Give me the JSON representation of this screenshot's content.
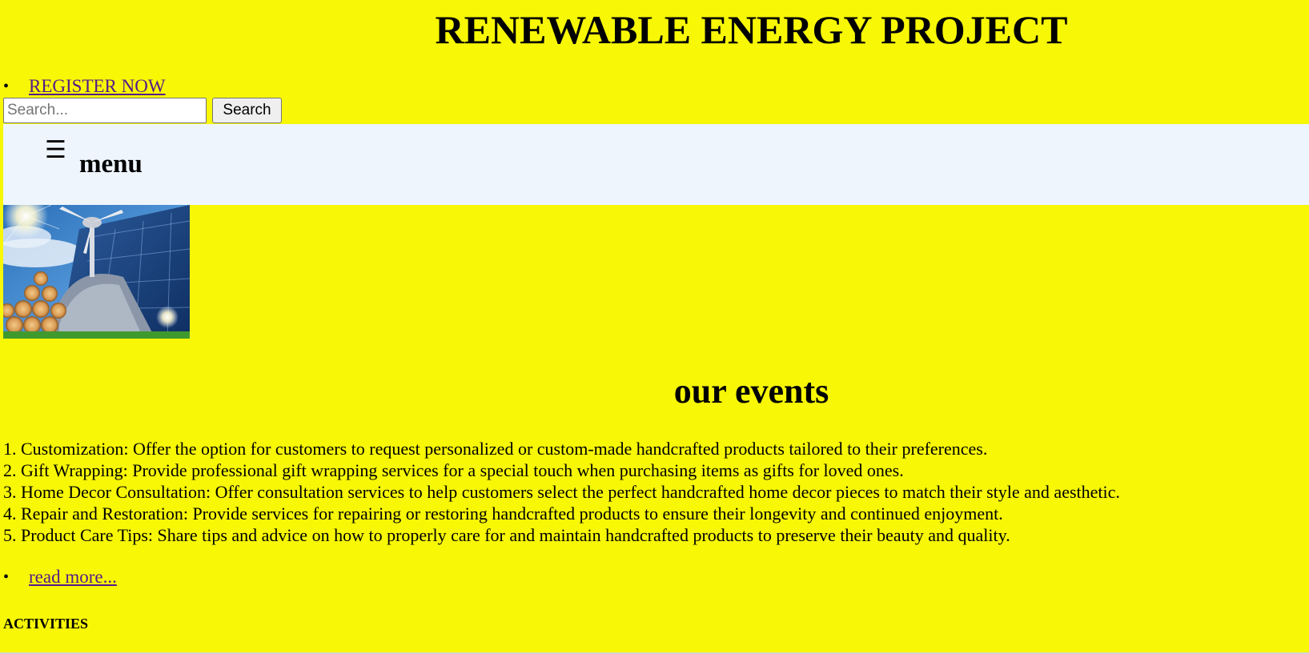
{
  "header": {
    "title": "RENEWABLE ENERGY PROJECT"
  },
  "nav": {
    "register_link": "REGISTER NOW"
  },
  "search": {
    "placeholder": "Search...",
    "value": "",
    "button_label": "Search"
  },
  "menu": {
    "icon": "☰",
    "icon_name": "hamburger-icon",
    "label": "menu"
  },
  "hero": {
    "image_name": "renewable-energy-image"
  },
  "events": {
    "title": "our events",
    "items": [
      "1. Customization: Offer the option for customers to request personalized or custom-made handcrafted products tailored to their preferences.",
      "2. Gift Wrapping: Provide professional gift wrapping services for a special touch when purchasing items as gifts for loved ones.",
      "3. Home Decor Consultation: Offer consultation services to help customers select the perfect handcrafted home decor pieces to match their style and aesthetic.",
      "4. Repair and Restoration: Provide services for repairing or restoring handcrafted products to ensure their longevity and continued enjoyment.",
      "5. Product Care Tips: Share tips and advice on how to properly care for and maintain handcrafted products to preserve their beauty and quality."
    ],
    "read_more": "read more..."
  },
  "activities": {
    "heading": "ACTIVITIES"
  },
  "colors": {
    "page_background": "#f7f706",
    "menu_background": "#eef5fd",
    "link": "#551a8b"
  }
}
